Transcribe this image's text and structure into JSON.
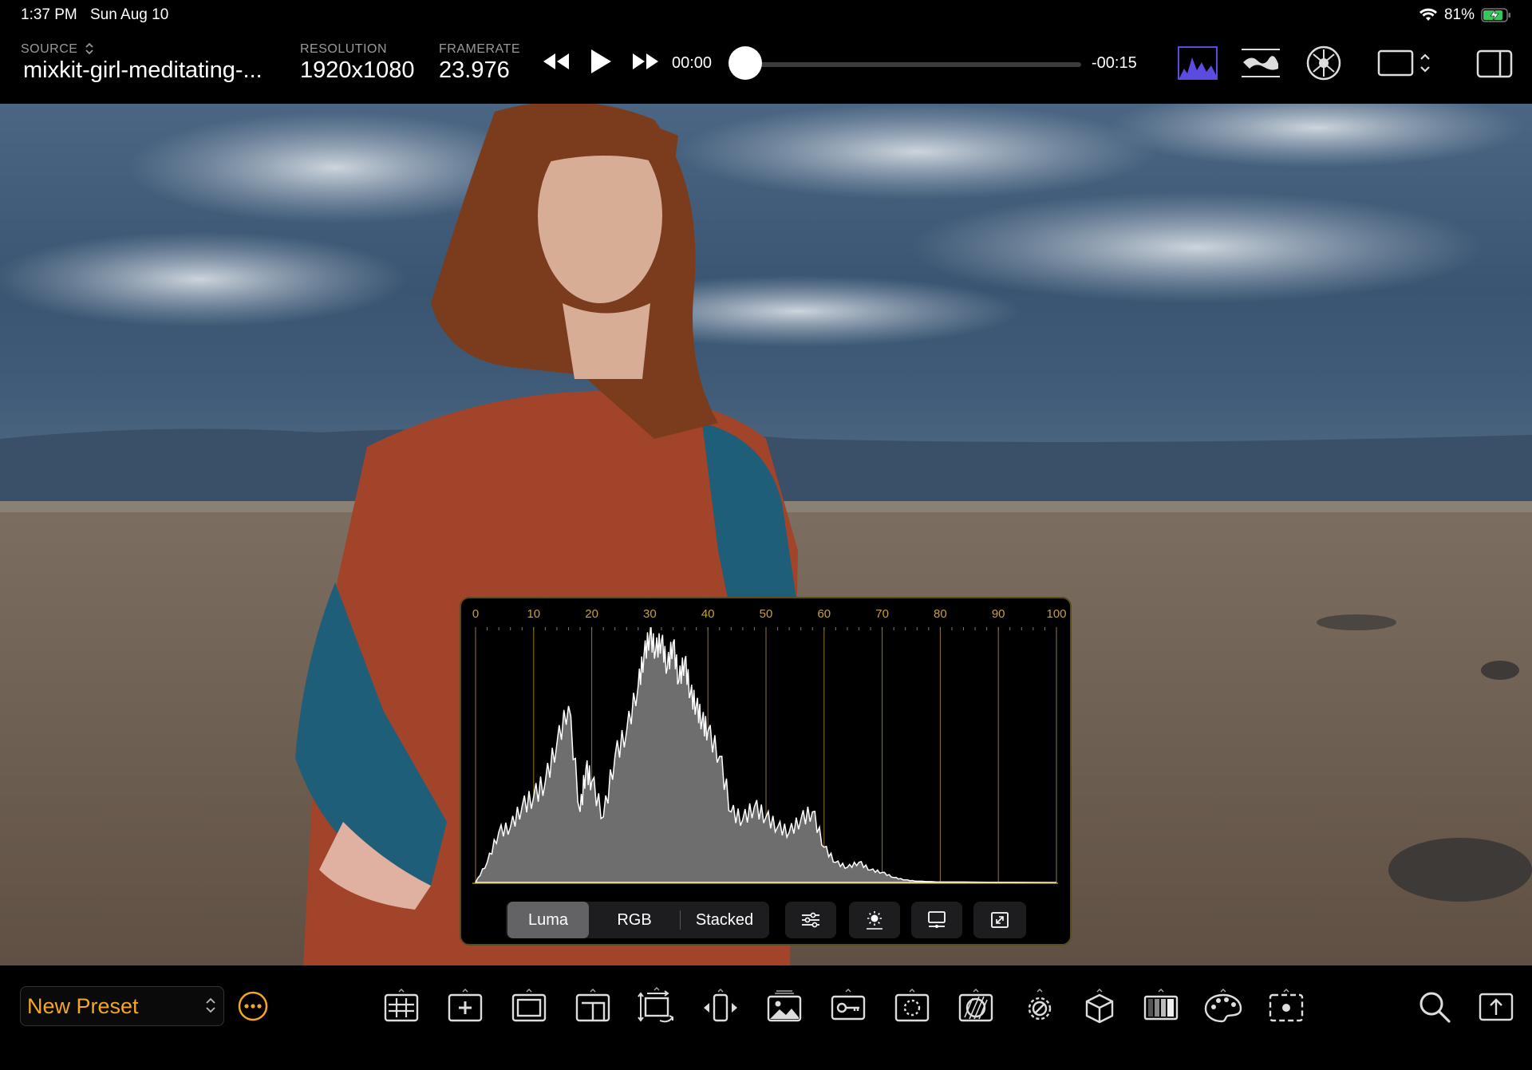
{
  "status_bar": {
    "time": "1:37 PM",
    "date": "Sun Aug 10",
    "battery": "81%",
    "wifi_icon": "wifi-icon",
    "battery_icon": "battery-charging-icon"
  },
  "header": {
    "source_label": "SOURCE",
    "source_value": "mixkit-girl-meditating-...",
    "resolution_label": "RESOLUTION",
    "resolution_value": "1920x1080",
    "framerate_label": "FRAMERATE",
    "framerate_value": "23.976"
  },
  "transport": {
    "current_time": "00:00",
    "remaining_time": "-00:15",
    "progress": 0.0
  },
  "histogram": {
    "scale_labels": [
      "0",
      "10",
      "20",
      "30",
      "40",
      "50",
      "60",
      "70",
      "80",
      "90",
      "100"
    ],
    "modes": [
      "Luma",
      "RGB",
      "Stacked"
    ],
    "active_mode": "Luma",
    "accent_color": "#c7a03a"
  },
  "chart_data": {
    "type": "area",
    "xlim": [
      0,
      100
    ],
    "x": [
      0,
      2,
      4,
      6,
      8,
      10,
      12,
      14,
      16,
      18,
      19,
      20,
      22,
      24,
      26,
      28,
      29,
      30,
      31,
      32,
      33,
      34,
      35,
      36,
      37,
      38,
      39,
      40,
      42,
      44,
      46,
      48,
      50,
      52,
      54,
      56,
      58,
      60,
      62,
      64,
      66,
      68,
      70,
      72,
      74,
      76,
      80,
      100
    ],
    "values": [
      0,
      8,
      20,
      22,
      30,
      34,
      40,
      55,
      70,
      28,
      45,
      40,
      26,
      50,
      60,
      78,
      90,
      98,
      92,
      96,
      85,
      95,
      80,
      88,
      75,
      70,
      64,
      60,
      50,
      28,
      25,
      30,
      26,
      22,
      20,
      25,
      28,
      14,
      8,
      6,
      8,
      5,
      4,
      2,
      1,
      0.5,
      0.2,
      0
    ]
  },
  "colors": {
    "accent_orange": "#f5a623",
    "scope_active": "#5a4ce0"
  },
  "preset": {
    "name": "New Preset"
  },
  "toolbar": {
    "icons": [
      "grid-icon",
      "crosshair-icon",
      "frame-icon",
      "layout-icon",
      "transform-icon",
      "mirror-icon",
      "image-icon",
      "key-icon",
      "focus-icon",
      "zebra-icon",
      "exposure-icon",
      "cube-lut-icon",
      "false-color-icon",
      "palette-icon",
      "spot-meter-icon"
    ]
  }
}
